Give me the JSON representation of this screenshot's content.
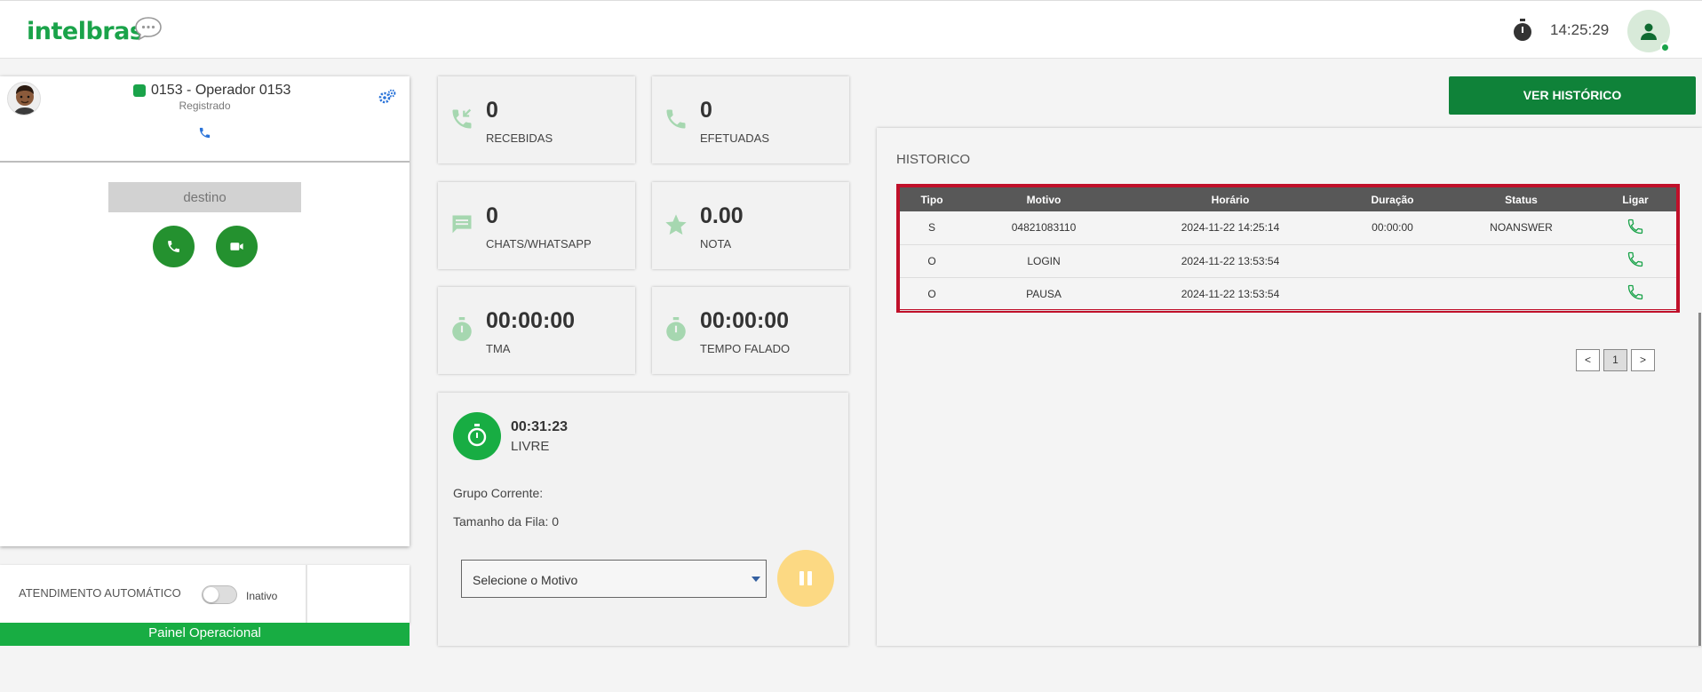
{
  "header": {
    "logo": "intelbras",
    "clock": "14:25:29"
  },
  "softphone": {
    "operator": "0153 - Operador 0153",
    "status": "Registrado",
    "destination_placeholder": "destino"
  },
  "auto_answer": {
    "label": "ATENDIMENTO AUTOMÁTICO",
    "state": "Inativo"
  },
  "footer_bar": "Painel Operacional",
  "stats": {
    "recebidas": {
      "value": "0",
      "label": "RECEBIDAS"
    },
    "efetuadas": {
      "value": "0",
      "label": "EFETUADAS"
    },
    "chats": {
      "value": "0",
      "label": "CHATS/WHATSAPP"
    },
    "nota": {
      "value": "0.00",
      "label": "NOTA"
    },
    "tma": {
      "value": "00:00:00",
      "label": "TMA"
    },
    "tempo_falado": {
      "value": "00:00:00",
      "label": "TEMPO FALADO"
    }
  },
  "agent_status": {
    "timer": "00:31:23",
    "state": "LIVRE",
    "grupo": "Grupo Corrente:",
    "fila": "Tamanho da Fila: 0",
    "motivo_placeholder": "Selecione o Motivo"
  },
  "history": {
    "button": "VER HISTÓRICO",
    "title": "HISTORICO",
    "columns": [
      "Tipo",
      "Motivo",
      "Horário",
      "Duração",
      "Status",
      "Ligar"
    ],
    "rows": [
      {
        "tipo": "S",
        "motivo": "04821083110",
        "horario": "2024-11-22 14:25:14",
        "duracao": "00:00:00",
        "status": "NOANSWER"
      },
      {
        "tipo": "O",
        "motivo": "LOGIN",
        "horario": "2024-11-22 13:53:54",
        "duracao": "",
        "status": ""
      },
      {
        "tipo": "O",
        "motivo": "PAUSA",
        "horario": "2024-11-22 13:53:54",
        "duracao": "",
        "status": ""
      }
    ],
    "pager": {
      "prev": "<",
      "page": "1",
      "next": ">"
    }
  },
  "colors": {
    "brand_green": "#1aa34a",
    "dark_green": "#0f8239",
    "highlight_red": "#c0102a",
    "pause_yellow": "#fcd983"
  }
}
